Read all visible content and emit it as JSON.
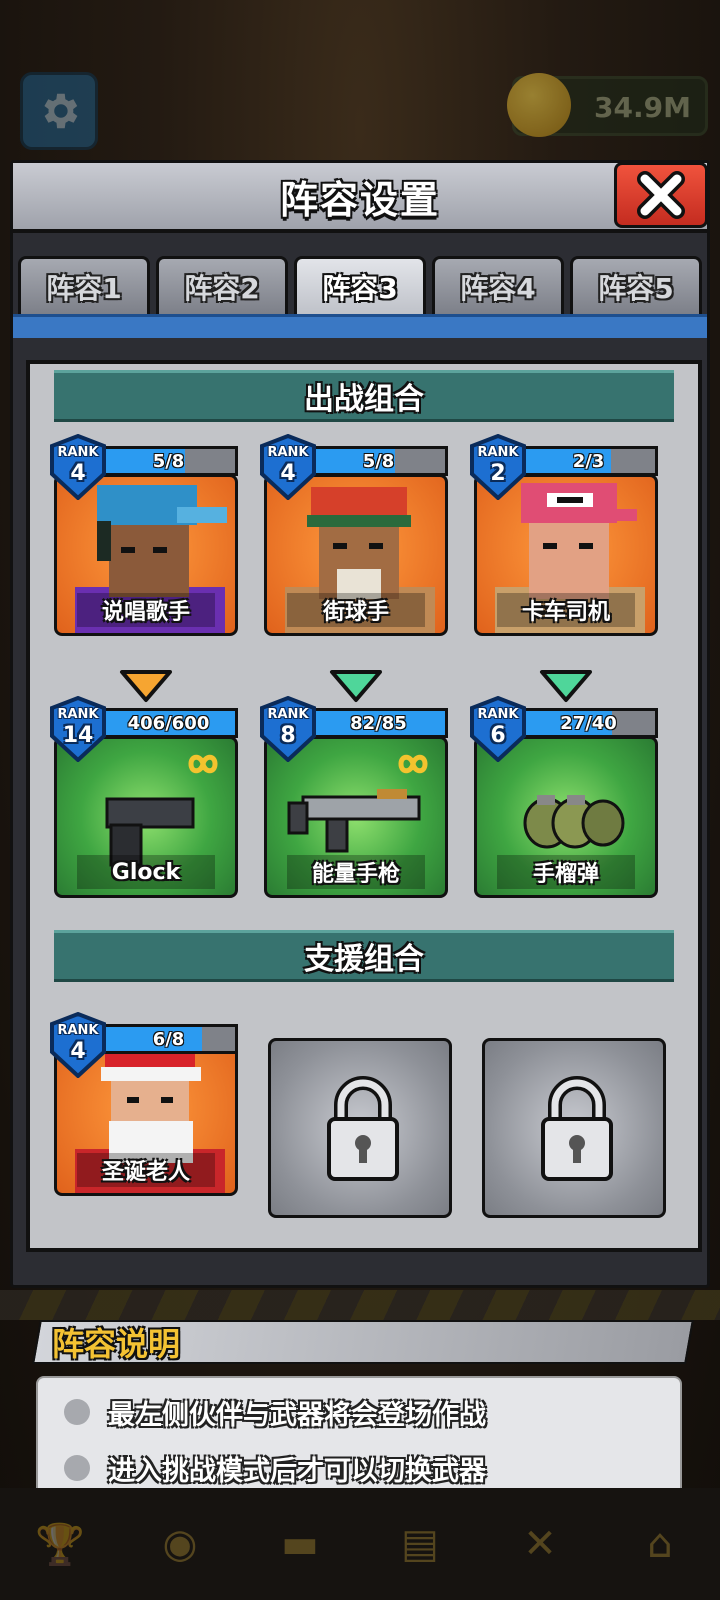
{
  "background": {
    "currency_value": "34.9M"
  },
  "modal": {
    "title": "阵容设置"
  },
  "tabs": [
    {
      "label": "阵容1",
      "active": false
    },
    {
      "label": "阵容2",
      "active": false
    },
    {
      "label": "阵容3",
      "active": true
    },
    {
      "label": "阵容4",
      "active": false
    },
    {
      "label": "阵容5",
      "active": false
    }
  ],
  "battle_section": {
    "title": "出战组合",
    "heroes": [
      {
        "rank_label": "RANK",
        "rank": "4",
        "progress": "5/8",
        "progress_fraction": 0.625,
        "name": "说唱歌手"
      },
      {
        "rank_label": "RANK",
        "rank": "4",
        "progress": "5/8",
        "progress_fraction": 0.625,
        "name": "街球手"
      },
      {
        "rank_label": "RANK",
        "rank": "2",
        "progress": "2/3",
        "progress_fraction": 0.667,
        "name": "卡车司机"
      }
    ],
    "arrows": [
      {
        "color": "#f6a531"
      },
      {
        "color": "#4fd69a"
      },
      {
        "color": "#4fd69a"
      }
    ],
    "weapons": [
      {
        "rank_label": "RANK",
        "rank": "14",
        "progress": "406/600",
        "progress_fraction": 1.0,
        "name": "Glock",
        "infinite_ammo": true
      },
      {
        "rank_label": "RANK",
        "rank": "8",
        "progress": "82/85",
        "progress_fraction": 1.0,
        "name": "能量手枪",
        "infinite_ammo": true
      },
      {
        "rank_label": "RANK",
        "rank": "6",
        "progress": "27/40",
        "progress_fraction": 0.675,
        "name": "手榴弹",
        "infinite_ammo": false
      }
    ]
  },
  "support_section": {
    "title": "支援组合",
    "heroes": [
      {
        "rank_label": "RANK",
        "rank": "4",
        "progress": "6/8",
        "progress_fraction": 0.75,
        "name": "圣诞老人"
      }
    ],
    "locked_slots": 2
  },
  "info": {
    "title": "阵容说明",
    "lines": [
      "最左侧伙伴与武器将会登场作战",
      "进入挑战模式后才可以切换武器"
    ]
  },
  "colors": {
    "hero_card": "#e9701f",
    "weapon_card": "#3fa642",
    "progress_fill": "#2b9bf1",
    "rank_badge": "#1d6fd1",
    "section_header": "#37736f",
    "close_button": "#d83a2a"
  },
  "icons": {
    "settings": "gear-icon",
    "close": "close-icon",
    "lock": "lock-icon",
    "infinity": "infinity-icon",
    "coin": "coin-icon"
  }
}
